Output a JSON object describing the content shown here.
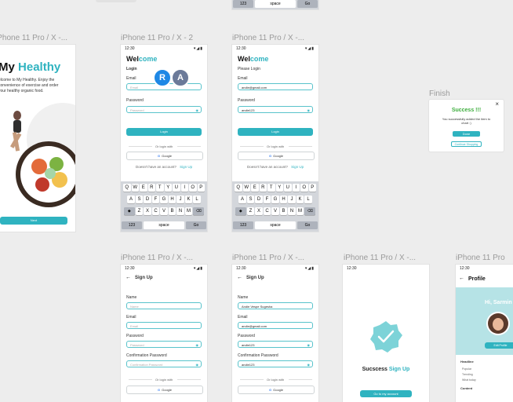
{
  "top_frame": {
    "kb_123": "123",
    "kb_space": "space",
    "kb_go": "Go"
  },
  "frames": {
    "welcome": {
      "label": "iPhone 11 Pro / X -...",
      "title_part1": "My ",
      "title_part2": "Healthy",
      "body": "elcome to My Healthy. Enjoy the convenience of exercise and order your healthy organic food.",
      "button": "Next"
    },
    "login1": {
      "label": "iPhone 11 Pro / X - 2"
    },
    "login2": {
      "label": "iPhone 11 Pro / X -..."
    },
    "signup1": {
      "label": "iPhone 11 Pro / X -..."
    },
    "signup2": {
      "label": "iPhone 11 Pro / X -..."
    },
    "success": {
      "label": "iPhone 11 Pro / X -..."
    },
    "profile": {
      "label": "iPhone 11 Pro"
    },
    "finish": {
      "label": "Finish"
    }
  },
  "status": {
    "time": "12:30",
    "icons": "▾◢▮"
  },
  "login": {
    "title_part1": "Wel",
    "title_part2": "come",
    "subtitle1": "Login",
    "subtitle2": "Please Login",
    "email_label": "Email",
    "email_placeholder": "Email",
    "email_value": "andie@gmail.com",
    "password_label": "Password",
    "password_placeholder": "Password",
    "password_value": "andie123",
    "login_button": "Login",
    "or_login": "Or login with",
    "google": "Google",
    "no_account": "Doesn't have an account?",
    "signup_link": "Sign Up"
  },
  "keyboard": {
    "row1": [
      "Q",
      "W",
      "E",
      "R",
      "T",
      "Y",
      "U",
      "I",
      "O",
      "P"
    ],
    "row2": [
      "A",
      "S",
      "D",
      "F",
      "G",
      "H",
      "J",
      "K",
      "L"
    ],
    "row3": [
      "Z",
      "X",
      "C",
      "V",
      "B",
      "N",
      "M"
    ],
    "shift": "◆",
    "backspace": "⌫",
    "num": "123",
    "space": "space",
    "go": "Go"
  },
  "collaborators": [
    {
      "initial": "R",
      "color": "#1e88e5"
    },
    {
      "initial": "A",
      "color": "#6b7a99"
    }
  ],
  "signup": {
    "title": "Sign Up",
    "name_label": "Name",
    "name_placeholder": "Name",
    "name_value": "Andie Vespe Sugesha",
    "email_label": "Email",
    "email_placeholder": "Email",
    "email_value": "andie@gmail.com",
    "password_label": "Password",
    "password_placeholder": "Password",
    "password_value": "andie123",
    "confirm_label": "Confirmation Password",
    "confirm_placeholder": "Confirmation Password",
    "confirm_value": "andie123",
    "or_login": "Or login with",
    "google": "Google"
  },
  "success_screen": {
    "text_part1": "Sucscess ",
    "text_part2": "Sign Up",
    "button": "Go to my account"
  },
  "profile": {
    "title": "Profile",
    "greeting": "Hi, Sarmin",
    "edit": "Edit Profile",
    "section1": "Headline",
    "items1": [
      "Popular",
      "Trending",
      "What today"
    ],
    "section2": "Content"
  },
  "dialog": {
    "title": "Success !!!",
    "message": "You successfully added the item to chart :)",
    "primary": "Done",
    "secondary": "Continue Shopping",
    "close": "×"
  }
}
